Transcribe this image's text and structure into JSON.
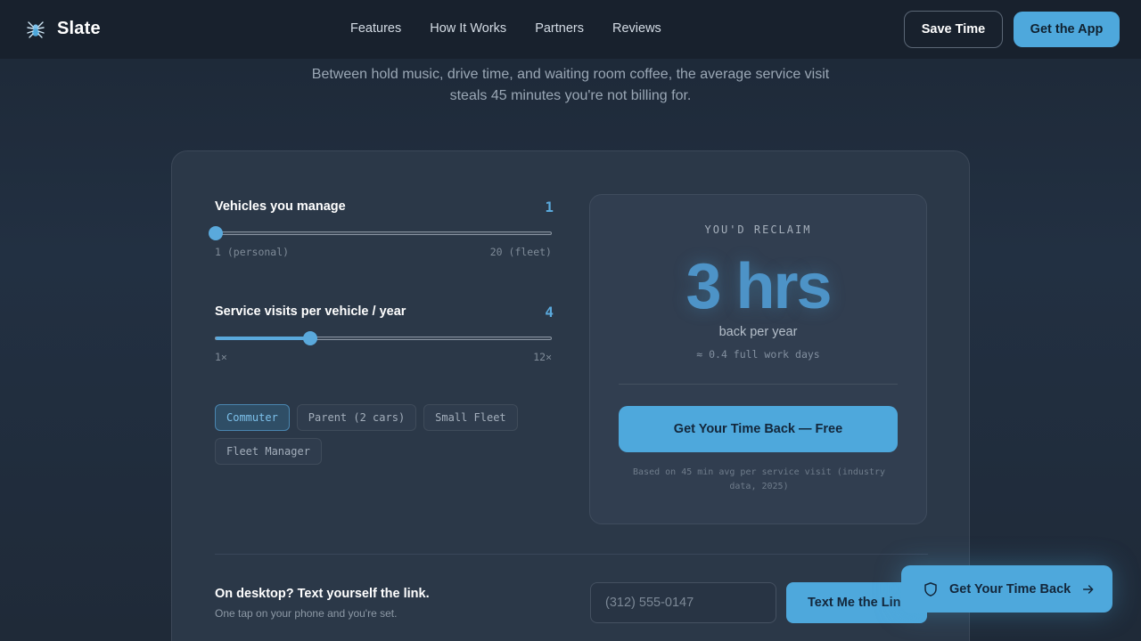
{
  "brand": {
    "name": "Slate",
    "icon": "spider-logo-icon"
  },
  "nav": {
    "links": [
      "Features",
      "How It Works",
      "Partners",
      "Reviews"
    ],
    "save_time_label": "Save Time",
    "get_app_label": "Get the App"
  },
  "hero": {
    "subtitle": "Between hold music, drive time, and waiting room coffee, the average service visit steals 45 minutes you're not billing for."
  },
  "calculator": {
    "vehicles": {
      "label": "Vehicles you manage",
      "value": "1",
      "min_label": "1 (personal)",
      "max_label": "20 (fleet)",
      "fraction": 0.0
    },
    "visits": {
      "label": "Service visits per vehicle / year",
      "value": "4",
      "min_label": "1×",
      "max_label": "12×",
      "fraction": 0.2818
    },
    "presets": [
      {
        "label": "Commuter",
        "active": true
      },
      {
        "label": "Parent (2 cars)",
        "active": false
      },
      {
        "label": "Small Fleet",
        "active": false
      },
      {
        "label": "Fleet Manager",
        "active": false
      }
    ],
    "result": {
      "kicker": "YOU'D RECLAIM",
      "value": "3 hrs",
      "subtitle": "back per year",
      "work_days": "≈ 0.4 full work days",
      "cta": "Get Your Time Back — Free",
      "note": "Based on 45 min avg per service visit (industry data, 2025)"
    }
  },
  "desktop_send": {
    "title": "On desktop? Text yourself the link.",
    "subtitle": "One tap on your phone and you're set.",
    "phone_placeholder": "(312) 555-0147",
    "button_label": "Text Me the Link"
  },
  "floating_cta": {
    "label": "Get Your Time Back",
    "icon": "shield-icon",
    "arrow_icon": "arrow-right-icon"
  },
  "colors": {
    "accent": "#4ea8dc",
    "background": "#1f2a37",
    "card": "#2b3848"
  }
}
